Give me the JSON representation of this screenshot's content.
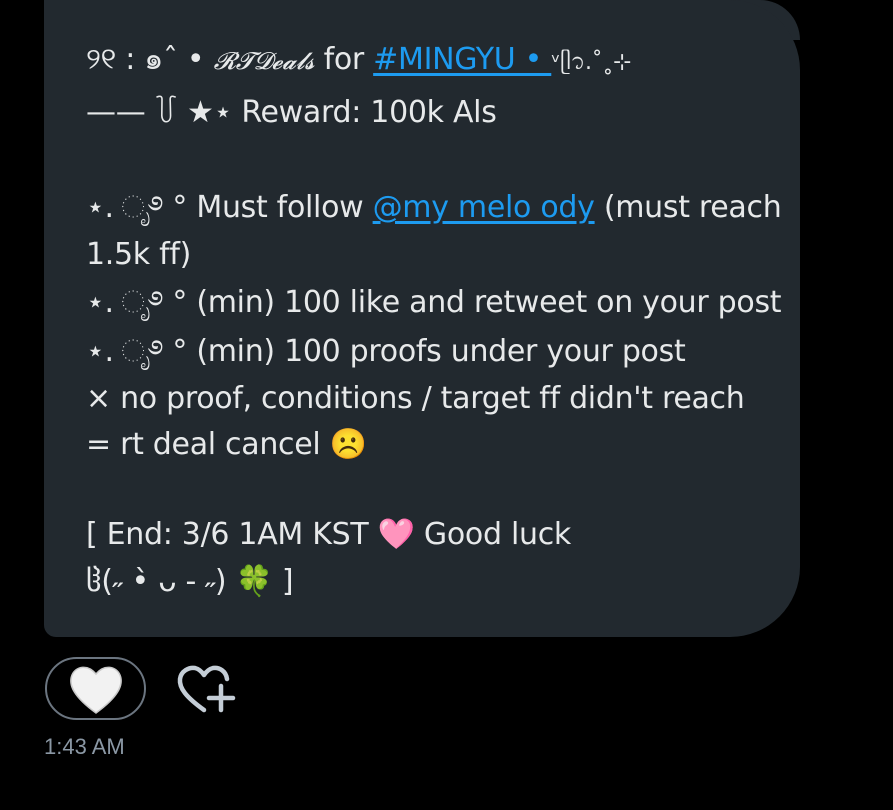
{
  "message": {
    "line1": {
      "prefix": "୨୧ : ๑ˆ • ",
      "script_text": "𝓡𝓣𝓓𝓮𝓪𝓵𝓼",
      "for_text": " for ",
      "hashtag": "#MINGYU • ",
      "suffix": " ᵛᥫ᭡.˚˳⊹"
    },
    "line2": "—— ꒦ ★⋆ Reward: 100k Als",
    "line3_prefix": "⋆. ೃ࿔ ° Must follow ",
    "mention": "@my melo ody",
    "line3_suffix": " (must reach",
    "line4": "1.5k ff)",
    "line5": "⋆. ೃ࿔ ° (min) 100 like and retweet on your post",
    "line6": "⋆. ೃ࿔ ° (min) 100 proofs under your post",
    "line7": "× no proof, conditions / target ff didn't reach",
    "line8_text": "= rt deal cancel ",
    "line8_emoji": "☹️",
    "line9_text_a": "[ End: 3/6 1AM KST ",
    "line9_emoji": "🩷",
    "line9_text_b": " Good luck",
    "line10_text": "ჱ(˶ •̀ ᴗ - ˶) ",
    "line10_emoji": "🍀",
    "line10_end": " ]"
  },
  "reactions": {
    "heart_emoji": "🤍"
  },
  "timestamp": "1:43 AM",
  "colors": {
    "background": "#000000",
    "bubble": "#22292f",
    "link": "#1d9bf0",
    "text": "#e7e9ea",
    "muted": "#8b98a5"
  },
  "icons": {
    "add_reaction": "heart-plus-icon"
  }
}
